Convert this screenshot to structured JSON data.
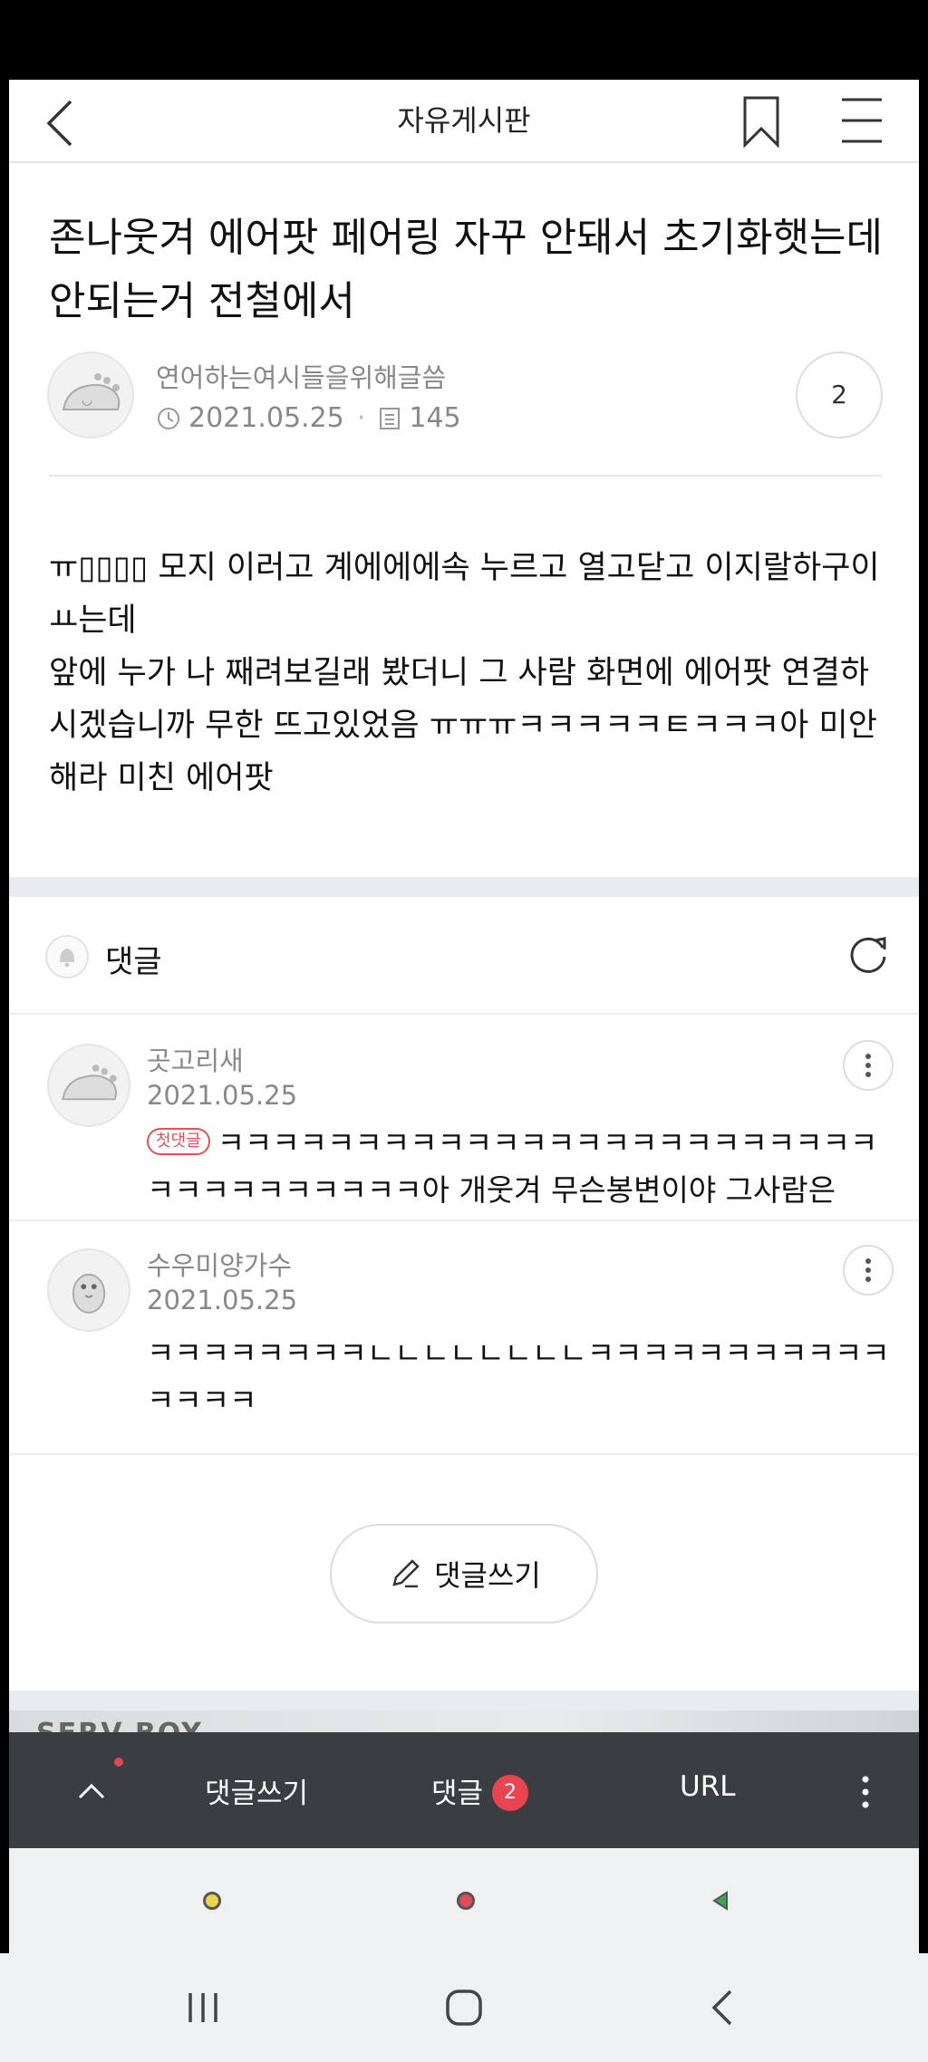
{
  "header": {
    "title": "자유게시판",
    "back_icon": "chevron-left-icon",
    "bookmark_icon": "bookmark-icon",
    "menu_icon": "hamburger-menu-icon"
  },
  "post": {
    "title": "존나웃겨 에어팟 페어링 자꾸 안돼서 초기화햇는데 안되는거 전철에서",
    "author": "연어하는여시들을위해글씀",
    "date": "2021.05.25",
    "views": "145",
    "comment_count": "2",
    "body": "ㅠ▯▯▯▯ 모지 이러고 계에에에속 누르고 열고닫고 이지랄하구이ㅛ는데\n앞에 누가 나 째려보길래 봤더니 그 사람 화면에 에어팟 연결하시겠습니까 무한 뜨고있었음 ㅠㅠㅠㅋㅋㅋㅋㅋㅌㅋㅋㅋ아 미안해라 미친 에어팟"
  },
  "comments_section": {
    "label": "댓글",
    "comments": [
      {
        "author": "곳고리새",
        "date": "2021.05.25",
        "badge": "첫댓글",
        "text": "ㅋㅋㅋㅋㅋㅋㅋㅋㅋㅋㅋㅋㅋㅋㅋㅋㅋㅋㅋㅋㅋㅋㅋㅋㅋㅋㅋㅋㅋㅋㅋㅋㅋㅋ아 개웃겨 무슨봉변이야 그사람은"
      },
      {
        "author": "수우미양가수",
        "date": "2021.05.25",
        "text": "ㅋㅋㅋㅋㅋㅋㅋㅋㄴㄴㄴㄴㄴㄴㄴㄴㅋㅋㅋㅋㅋㅋㅋㅋㅋㅋㅋㅋㅋㅋㅋ"
      }
    ],
    "write_button": "댓글쓰기"
  },
  "ad": {
    "text": "SERV BOY"
  },
  "action_bar": {
    "write": "댓글쓰기",
    "comments": "댓글",
    "comments_badge": "2",
    "url": "URL"
  },
  "colors": {
    "accent_red": "#e94452",
    "action_bar_bg": "#3a3d41",
    "dot_yellow": "#e8d44d",
    "dot_red": "#e24a58",
    "dot_green": "#3fa34d"
  }
}
